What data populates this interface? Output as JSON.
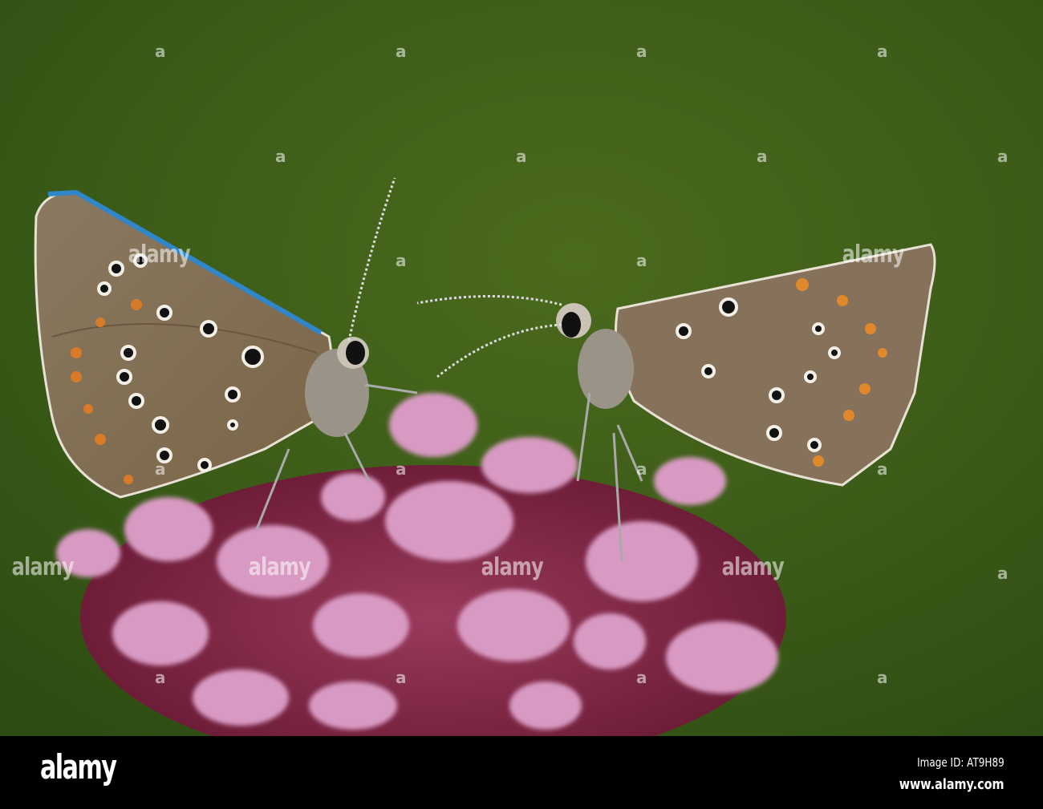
{
  "image": {
    "subject": "two common blue butterflies on marjoram flower"
  },
  "watermark": {
    "text": "alamy",
    "letter": "a"
  },
  "footer": {
    "logo": "alamy",
    "image_id": "Image ID: AT9H89",
    "website": "www.alamy.com"
  }
}
